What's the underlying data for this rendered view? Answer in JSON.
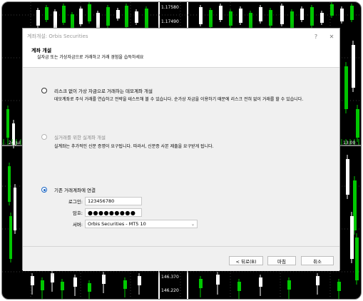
{
  "window": {
    "title": "계좌개설: Orbis Securities",
    "help_glyph": "?",
    "close_glyph": "✕"
  },
  "header": {
    "title": "계좌 개설",
    "subtitle": "실자금 또는 가상자금으로 거래하고 거래 경험을 습득하세요"
  },
  "options": [
    {
      "label": "리스크 없이 가상 자금으로 거래하는 데모계좌 개설",
      "description": "데모계좌로 주식 거래를 연습하고 전략을 테스트해 볼 수 있습니다. 순가상 자금을 이용하기 때문에 리스크 전혀 없이 거래를 할 수 있습니다.",
      "state": "unchecked"
    },
    {
      "label": "실거래를 위한 실계좌 개설",
      "description": "실계좌는 추가적인 신분 증명이 요구됩니다. 따라서, 신분증 사본 제출을 요구받게 됩니다.",
      "state": "disabled"
    },
    {
      "label": "기존 거래계좌에 연결",
      "state": "checked"
    }
  ],
  "login": {
    "login_label": "로그인:",
    "login_value": "123456780",
    "password_label": "암호:",
    "password_value": "●●●●●●●●●",
    "server_label": "서버:",
    "server_value": "Orbis Securities - MT5 10"
  },
  "buttons": {
    "back": "< 뒤로(B)",
    "finish": "마침",
    "cancel": "취소"
  },
  "chart": {
    "price_top": "1.17580",
    "price_second": "1.17490",
    "price_mid": "146.370",
    "price_low": "146.220",
    "time_left": "24 Jul",
    "time_right": "13:00",
    "colors": {
      "bull": "#00c800",
      "bear": "#ffffff",
      "grid": "#3a3a3a"
    }
  }
}
